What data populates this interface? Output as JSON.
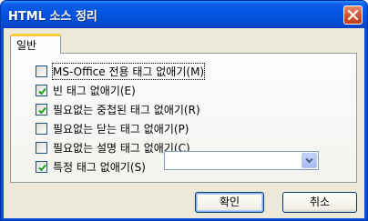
{
  "window": {
    "title": "HTML 소스 정리",
    "close_icon": "close-icon"
  },
  "tabs": [
    {
      "label": "일반",
      "active": true
    }
  ],
  "options": [
    {
      "label": "MS-Office 전용 태그 없애기(M)",
      "checked": false
    },
    {
      "label": "빈 태그 없애기(E)",
      "checked": true
    },
    {
      "label": "필요없는 중첩된 태그 없애기(R)",
      "checked": true
    },
    {
      "label": "필요없는 닫는 태그 없애기(P)",
      "checked": false
    },
    {
      "label": "필요없는 설명 태그 없애기(C)",
      "checked": false
    },
    {
      "label": "특정 태그 없애기(S)",
      "checked": true
    }
  ],
  "specific_tag_select": {
    "value": ""
  },
  "buttons": {
    "ok_label": "확인",
    "cancel_label": "취소"
  },
  "colors": {
    "titlebar": "#0454e0",
    "dialog_bg": "#ece9d8",
    "tab_accent": "#ffc83c",
    "check_mark": "#21a121"
  }
}
